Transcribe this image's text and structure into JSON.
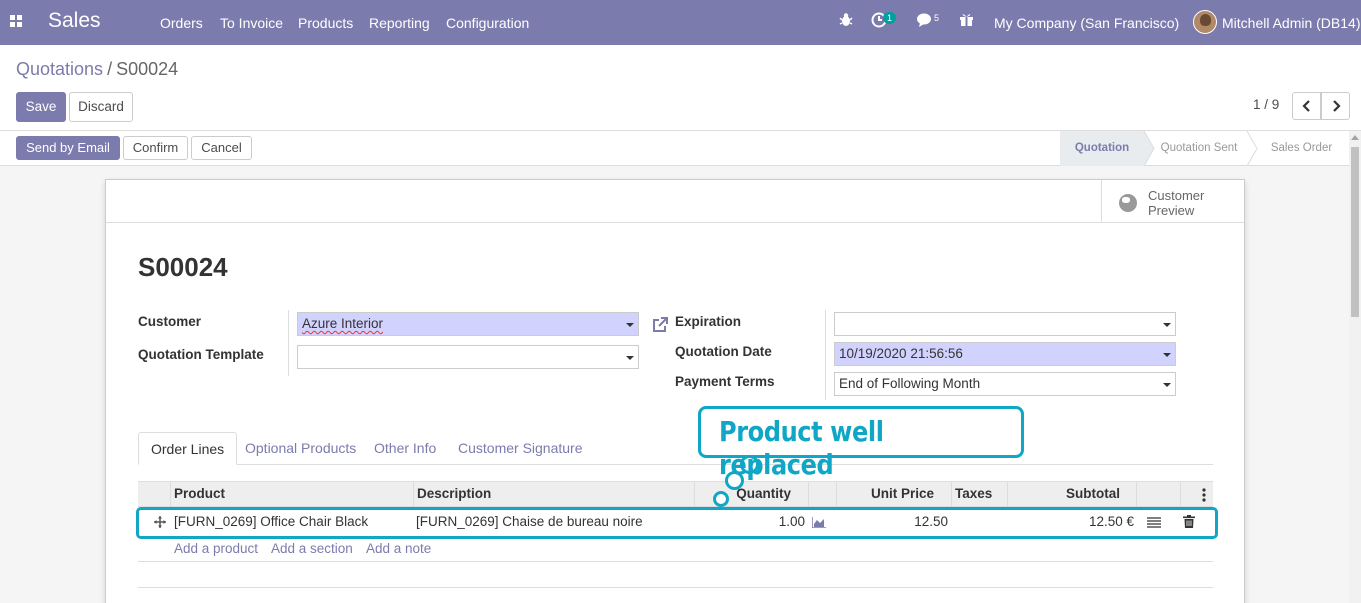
{
  "navbar": {
    "app_name": "Sales",
    "menu": [
      "Orders",
      "To Invoice",
      "Products",
      "Reporting",
      "Configuration"
    ],
    "activity_count": "1",
    "message_count": "5",
    "company": "My Company (San Francisco)",
    "user": "Mitchell Admin (DB14)",
    "color": "#7c7bad"
  },
  "breadcrumb": {
    "parent": "Quotations",
    "separator": "/",
    "current": "S00024"
  },
  "actions": {
    "save": "Save",
    "discard": "Discard"
  },
  "pager": {
    "value": "1 / 9"
  },
  "status_actions": {
    "send_email": "Send by Email",
    "confirm": "Confirm",
    "cancel": "Cancel"
  },
  "stages": [
    "Quotation",
    "Quotation Sent",
    "Sales Order"
  ],
  "active_stage": "Quotation",
  "sheet": {
    "preview_label_1": "Customer",
    "preview_label_2": "Preview",
    "title": "S00024"
  },
  "fields": {
    "customer_label": "Customer",
    "customer_value": "Azure Interior",
    "template_label": "Quotation Template",
    "template_value": "",
    "expiration_label": "Expiration",
    "expiration_value": "",
    "date_label": "Quotation Date",
    "date_value": "10/19/2020 21:56:56",
    "terms_label": "Payment Terms",
    "terms_value": "End of Following Month"
  },
  "tabs": [
    "Order Lines",
    "Optional Products",
    "Other Info",
    "Customer Signature"
  ],
  "table": {
    "headers": {
      "product": "Product",
      "description": "Description",
      "quantity": "Quantity",
      "unit_price": "Unit Price",
      "taxes": "Taxes",
      "subtotal": "Subtotal"
    },
    "rows": [
      {
        "product": "[FURN_0269] Office Chair Black",
        "description": "[FURN_0269] Chaise de bureau noire",
        "quantity": "1.00",
        "unit_price": "12.50",
        "taxes": "",
        "subtotal": "12.50 €"
      }
    ],
    "add_links": [
      "Add a product",
      "Add a section",
      "Add a note"
    ]
  },
  "annotation": {
    "text": "Product well replaced",
    "color": "#10a6c6"
  }
}
